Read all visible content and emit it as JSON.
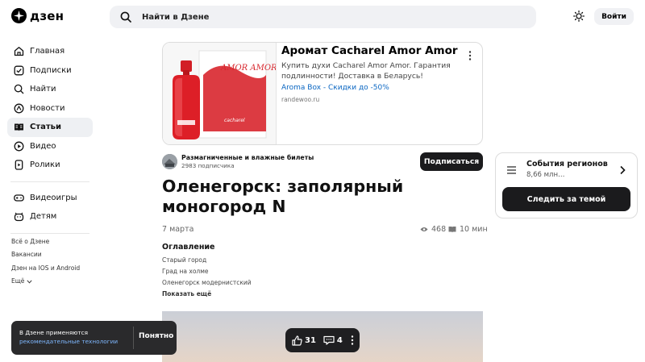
{
  "header": {
    "logo_text": "дзен",
    "search_placeholder": "Найти в Дзене",
    "login_label": "Войти"
  },
  "sidebar": {
    "items": [
      {
        "label": "Главная",
        "icon": "home-icon"
      },
      {
        "label": "Подписки",
        "icon": "subscriptions-icon"
      },
      {
        "label": "Найти",
        "icon": "search-icon"
      },
      {
        "label": "Новости",
        "icon": "news-icon"
      },
      {
        "label": "Статьи",
        "icon": "articles-icon",
        "active": true
      },
      {
        "label": "Видео",
        "icon": "video-icon"
      },
      {
        "label": "Ролики",
        "icon": "clips-icon"
      }
    ],
    "extra_items": [
      {
        "label": "Видеоигры",
        "icon": "gamepad-icon"
      },
      {
        "label": "Детям",
        "icon": "kids-icon"
      }
    ],
    "footer_links": [
      "Всё о Дзене",
      "Вакансии",
      "Дзен на IOS и Android"
    ],
    "more_label": "Ещё"
  },
  "ad": {
    "title": "Аромат Cacharel Amor Amor",
    "description": "Купить духи Cacharel Amor Amor. Гарантия подлинности! Доставка в Беларусь!",
    "link_text": "Aroma Box - Скидки до -50%",
    "domain": "randewoo.ru",
    "image_box_text": "AMOR AMOR",
    "image_brand_text": "cacharel"
  },
  "channel": {
    "name": "Размагниченные и влажные билеты",
    "subscribers": "2983 подписчика",
    "subscribe_label": "Подписаться"
  },
  "article": {
    "title": "Оленегорск: заполярный моногород N",
    "date": "7 марта",
    "views": "468",
    "read_time": "10 мин",
    "toc_title": "Оглавление",
    "toc_items": [
      "Старый город",
      "Град на холме",
      "Оленегорск модернистский"
    ],
    "toc_more": "Показать ещё"
  },
  "topic_card": {
    "title": "События регионов",
    "count": "8,66 млн…",
    "follow_label": "Следить за темой"
  },
  "cookie": {
    "text": "В Дзене применяются",
    "link": "рекомендательные технологии",
    "button": "Понятно"
  },
  "reactions": {
    "likes": "31",
    "comments": "4"
  }
}
